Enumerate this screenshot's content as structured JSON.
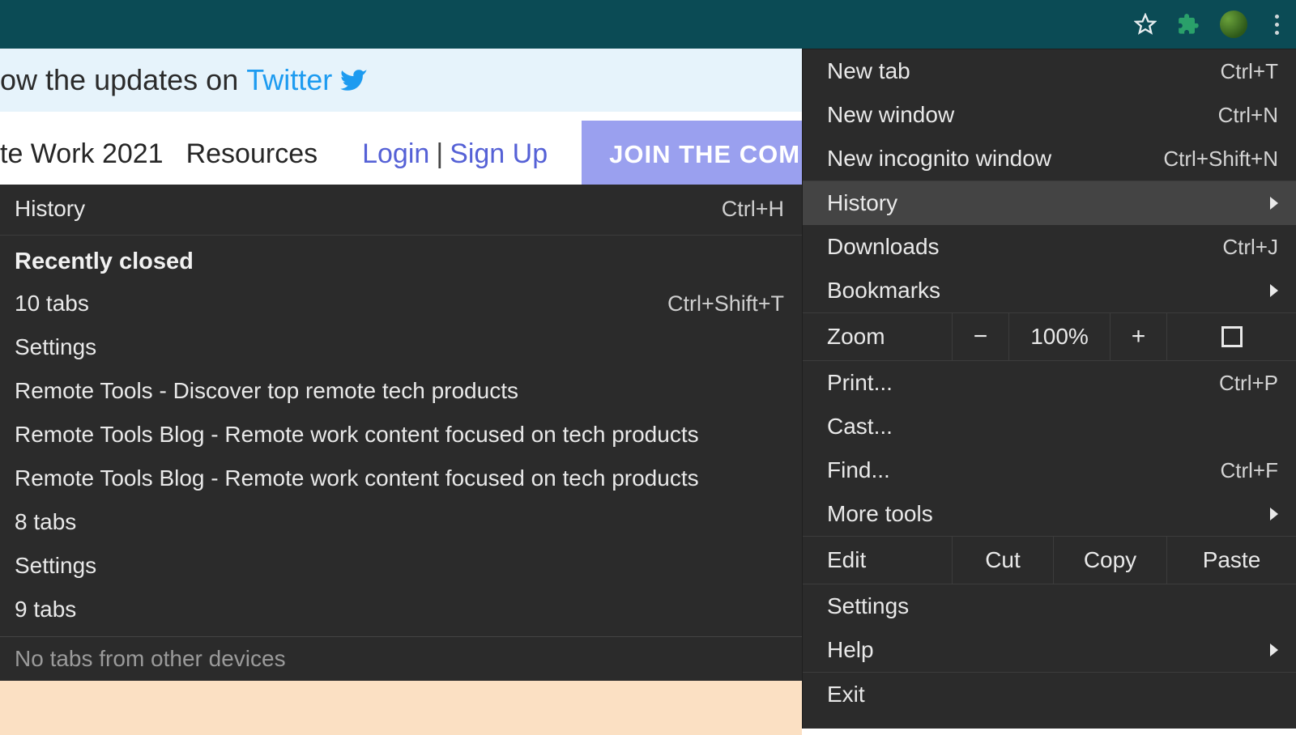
{
  "toolbar": {
    "star_title": "Bookmark this page",
    "extensions_title": "Extensions",
    "profile_title": "Profile",
    "menu_title": "Customize and control"
  },
  "page": {
    "banner_prefix": "ow the updates on ",
    "banner_link": "Twitter",
    "nav_item_1": "te Work 2021",
    "nav_item_2": "Resources",
    "login": "Login",
    "pipe": "|",
    "signup": "Sign Up",
    "join_btn": "JOIN THE COMM"
  },
  "history_submenu": {
    "header_label": "History",
    "header_shortcut": "Ctrl+H",
    "recently_closed_heading": "Recently closed",
    "items": [
      {
        "label": "10 tabs",
        "shortcut": "Ctrl+Shift+T"
      },
      {
        "label": "Settings",
        "shortcut": ""
      },
      {
        "label": "Remote Tools - Discover top remote tech products",
        "shortcut": ""
      },
      {
        "label": "Remote Tools Blog - Remote work content focused on tech products",
        "shortcut": ""
      },
      {
        "label": "Remote Tools Blog - Remote work content focused on tech products",
        "shortcut": ""
      },
      {
        "label": "8 tabs",
        "shortcut": ""
      },
      {
        "label": "Settings",
        "shortcut": ""
      },
      {
        "label": "9 tabs",
        "shortcut": ""
      }
    ],
    "footer": "No tabs from other devices"
  },
  "main_menu": {
    "new_tab": "New tab",
    "new_tab_shortcut": "Ctrl+T",
    "new_window": "New window",
    "new_window_shortcut": "Ctrl+N",
    "incognito": "New incognito window",
    "incognito_shortcut": "Ctrl+Shift+N",
    "history": "History",
    "downloads": "Downloads",
    "downloads_shortcut": "Ctrl+J",
    "bookmarks": "Bookmarks",
    "zoom_label": "Zoom",
    "zoom_out": "−",
    "zoom_value": "100%",
    "zoom_in": "+",
    "print": "Print...",
    "print_shortcut": "Ctrl+P",
    "cast": "Cast...",
    "find": "Find...",
    "find_shortcut": "Ctrl+F",
    "more_tools": "More tools",
    "edit_label": "Edit",
    "cut": "Cut",
    "copy": "Copy",
    "paste": "Paste",
    "settings": "Settings",
    "help": "Help",
    "exit": "Exit"
  }
}
